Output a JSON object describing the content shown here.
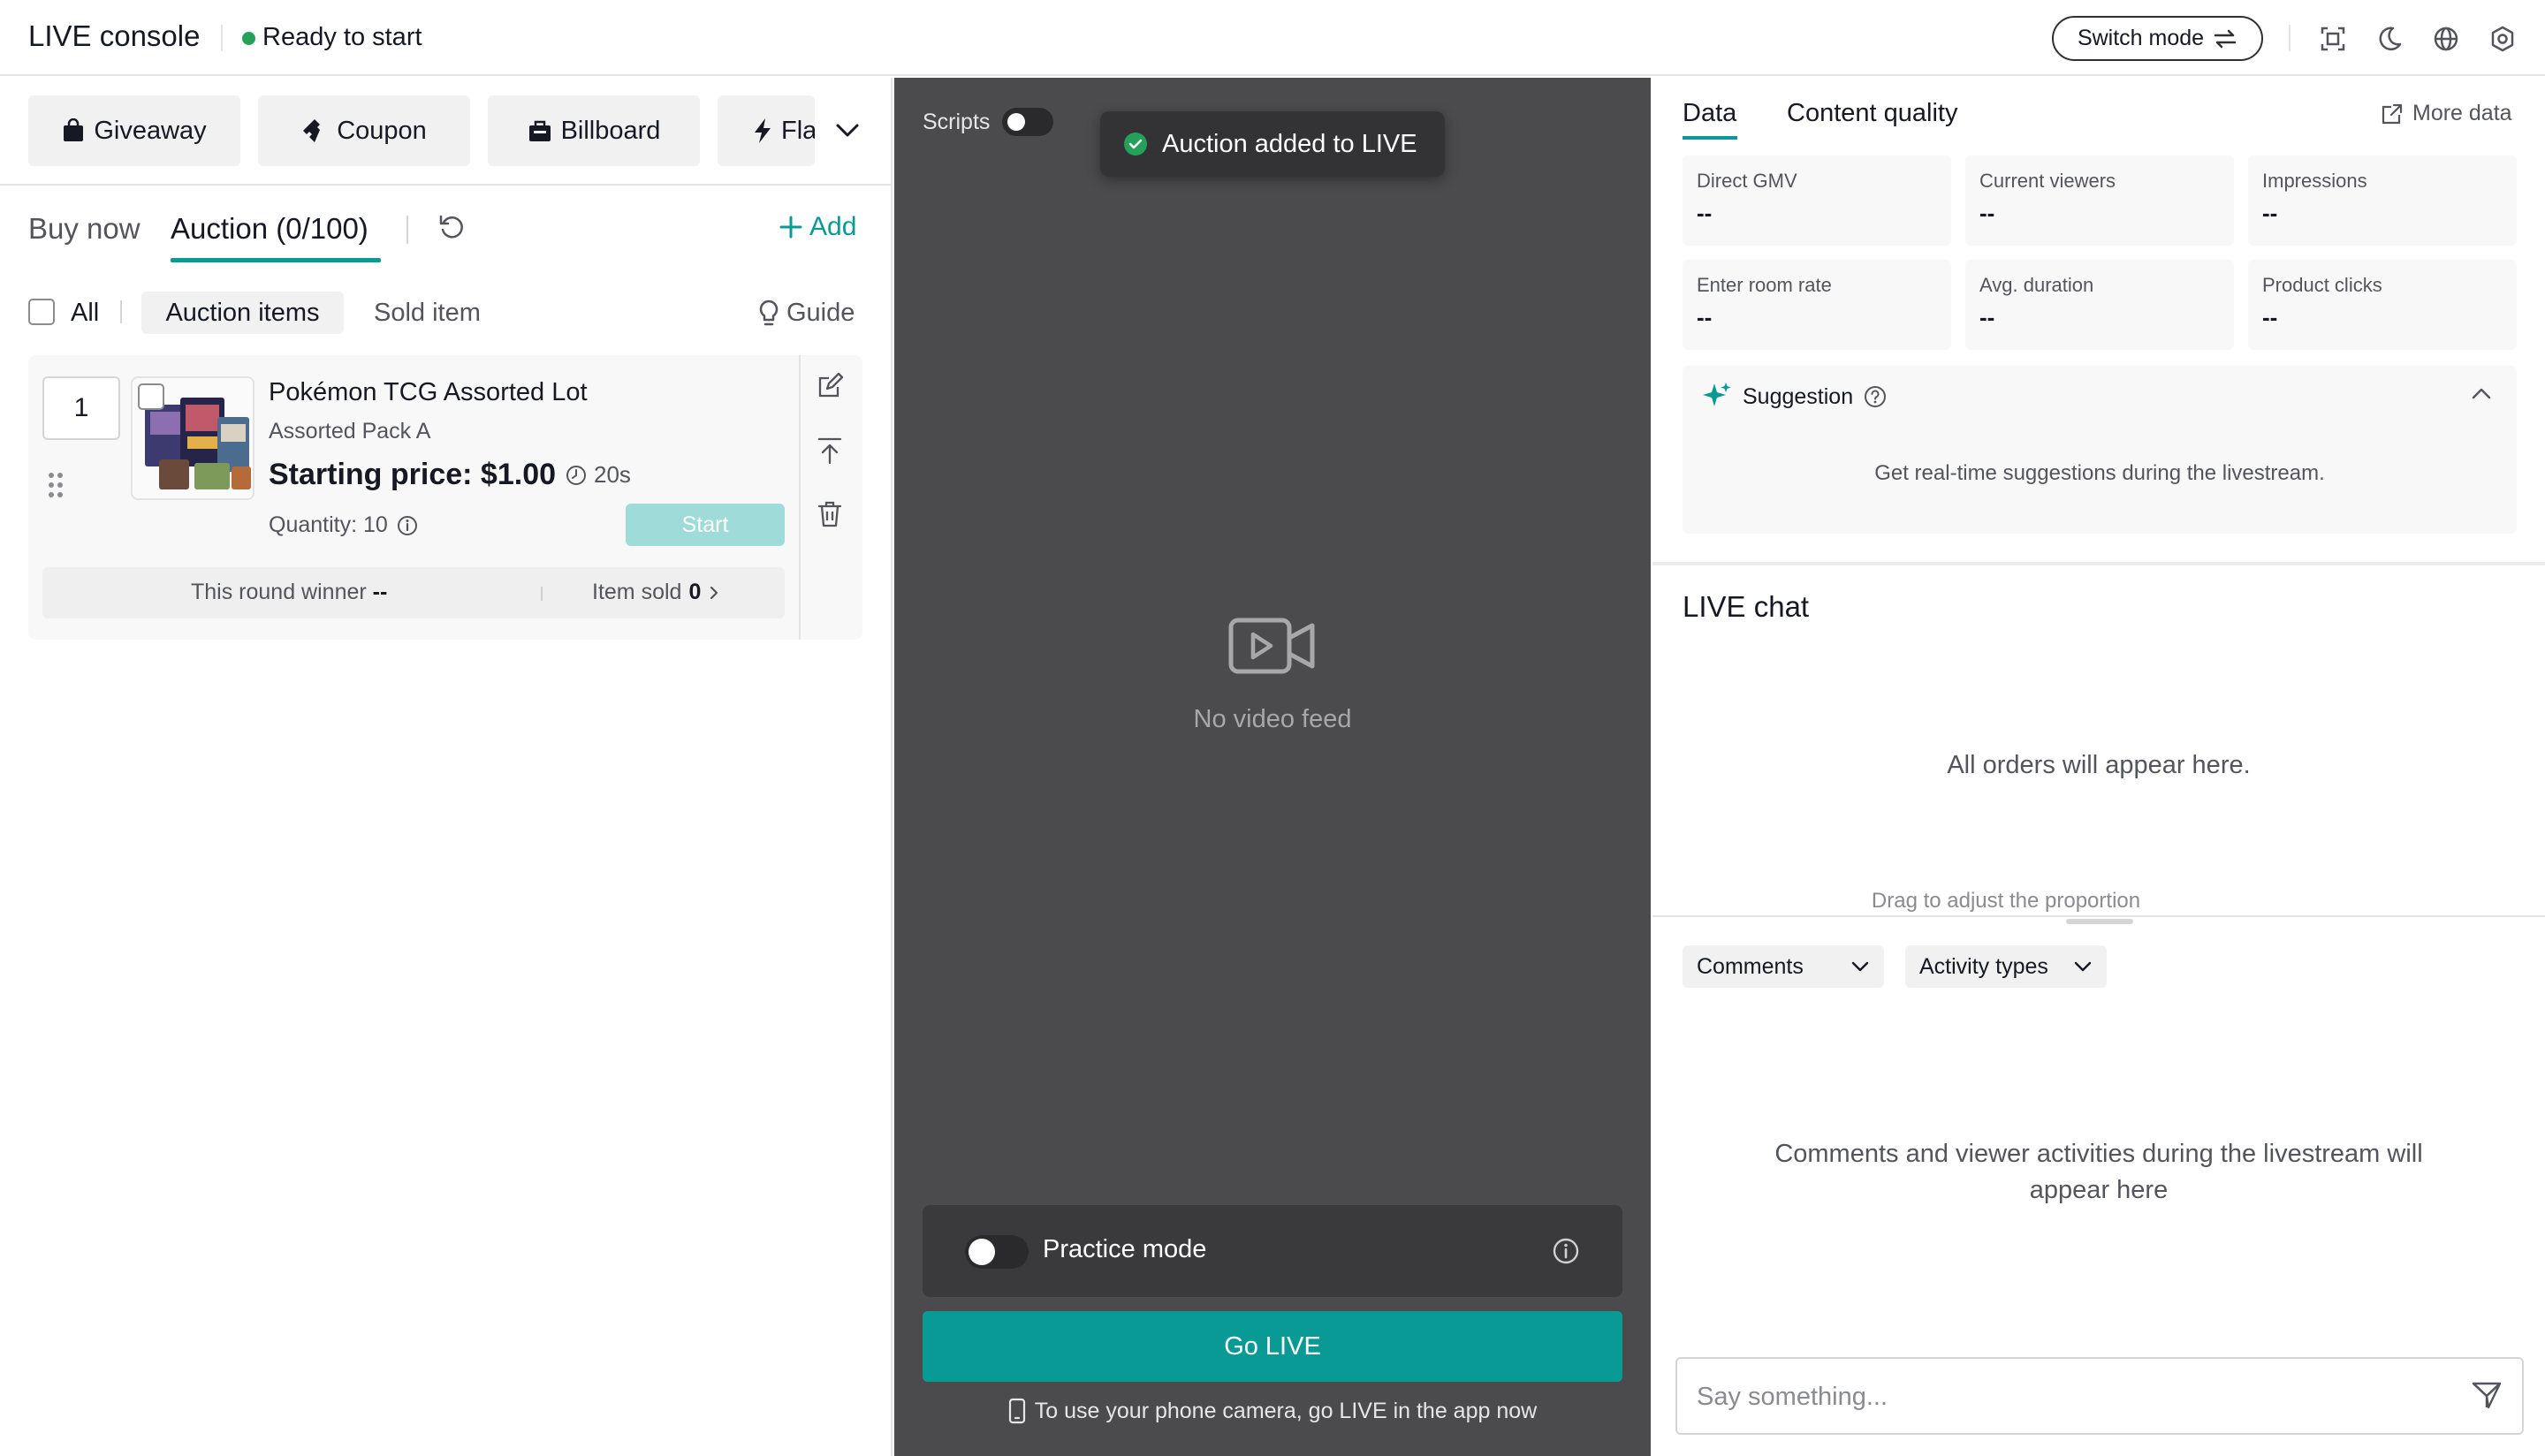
{
  "header": {
    "title": "LIVE console",
    "status": "Ready to start",
    "switch_mode": "Switch mode"
  },
  "tools": {
    "giveaway": "Giveaway",
    "coupon": "Coupon",
    "billboard": "Billboard",
    "flash": "Fla"
  },
  "tabs": {
    "buy_now": "Buy now",
    "auction": "Auction (0/100)",
    "add": "Add"
  },
  "filters": {
    "all": "All",
    "auction_items": "Auction items",
    "sold_item": "Sold item",
    "guide": "Guide"
  },
  "item": {
    "index": "1",
    "title": "Pokémon TCG Assorted Lot",
    "subtitle": "Assorted Pack A",
    "price": "Starting price: $1.00",
    "timer": "20s",
    "quantity": "Quantity: 10",
    "start": "Start",
    "winner_label": "This round winner",
    "winner_value": "--",
    "sold_label": "Item sold",
    "sold_value": "0"
  },
  "video": {
    "scripts": "Scripts",
    "toast": "Auction added to LIVE",
    "no_feed": "No video feed",
    "practice_mode": "Practice mode",
    "go_live": "Go LIVE",
    "phone_hint": "To use your phone camera, go LIVE in the app now"
  },
  "data_panel": {
    "tab_data": "Data",
    "tab_quality": "Content quality",
    "more_data": "More data",
    "metrics": [
      {
        "label": "Direct GMV",
        "value": "--"
      },
      {
        "label": "Current viewers",
        "value": "--"
      },
      {
        "label": "Impressions",
        "value": "--"
      },
      {
        "label": "Enter room rate",
        "value": "--"
      },
      {
        "label": "Avg. duration",
        "value": "--"
      },
      {
        "label": "Product clicks",
        "value": "--"
      }
    ],
    "suggestion_title": "Suggestion",
    "suggestion_text": "Get real-time suggestions during the livestream."
  },
  "chat": {
    "title": "LIVE chat",
    "orders_empty": "All orders will appear here.",
    "drag_hint": "Drag to adjust the proportion",
    "comments_select": "Comments",
    "activity_select": "Activity types",
    "comments_empty": "Comments and viewer activities during the livestream will appear here",
    "input_placeholder": "Say something..."
  },
  "colors": {
    "accent": "#0a9a96",
    "status_green": "#25a05a",
    "video_bg": "#4b4b4d"
  }
}
